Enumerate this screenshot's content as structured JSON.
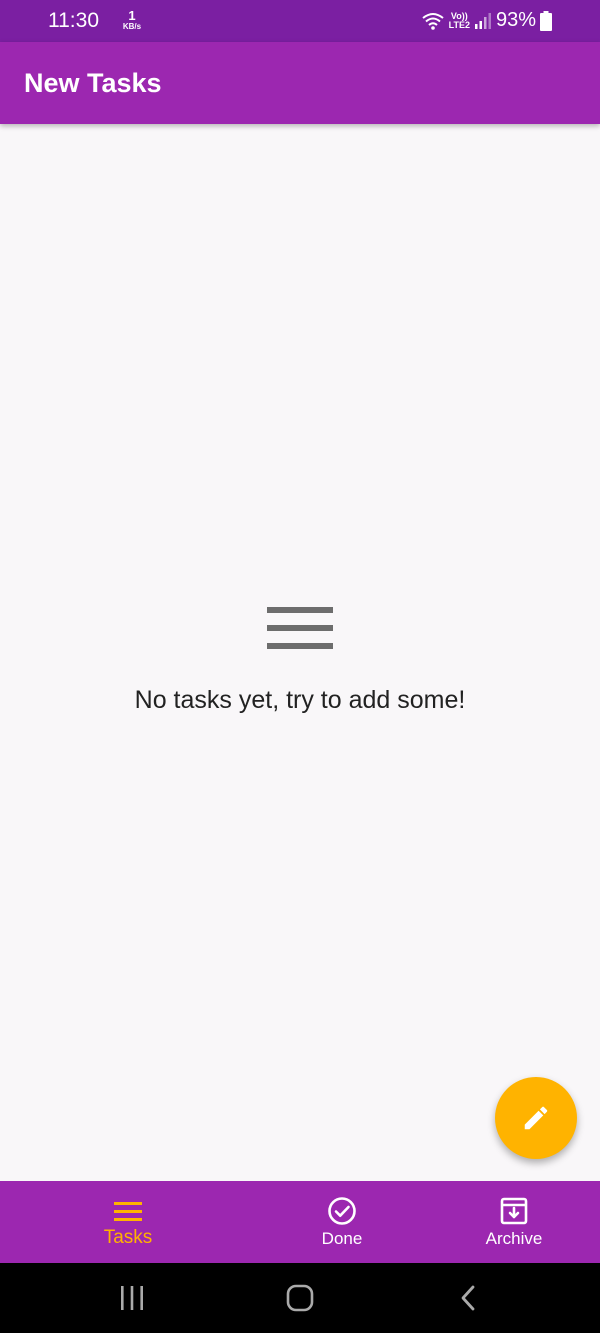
{
  "status_bar": {
    "time": "11:30",
    "speed_value": "1",
    "speed_unit": "KB/s",
    "network_line1": "Vo))",
    "network_line2": "LTE2",
    "battery": "93%",
    "icons": [
      "wifi-icon",
      "signal-icon",
      "battery-icon"
    ]
  },
  "app_bar": {
    "title": "New Tasks"
  },
  "empty_state": {
    "icon": "menu-lines-icon",
    "message": "No tasks yet, try to add some!"
  },
  "fab": {
    "icon": "pencil-icon"
  },
  "bottom_nav": {
    "items": [
      {
        "label": "Tasks",
        "icon": "menu-icon",
        "active": true
      },
      {
        "label": "Done",
        "icon": "check-circle-icon",
        "active": false
      },
      {
        "label": "Archive",
        "icon": "archive-icon",
        "active": false
      }
    ]
  },
  "system_nav": {
    "buttons": [
      "recents-icon",
      "home-icon",
      "back-icon"
    ]
  },
  "colors": {
    "status_bar": "#7b1fa2",
    "primary": "#9c27b0",
    "accent": "#ffb300",
    "background": "#f9f7f9",
    "icon_gray": "#6d6d6d"
  }
}
